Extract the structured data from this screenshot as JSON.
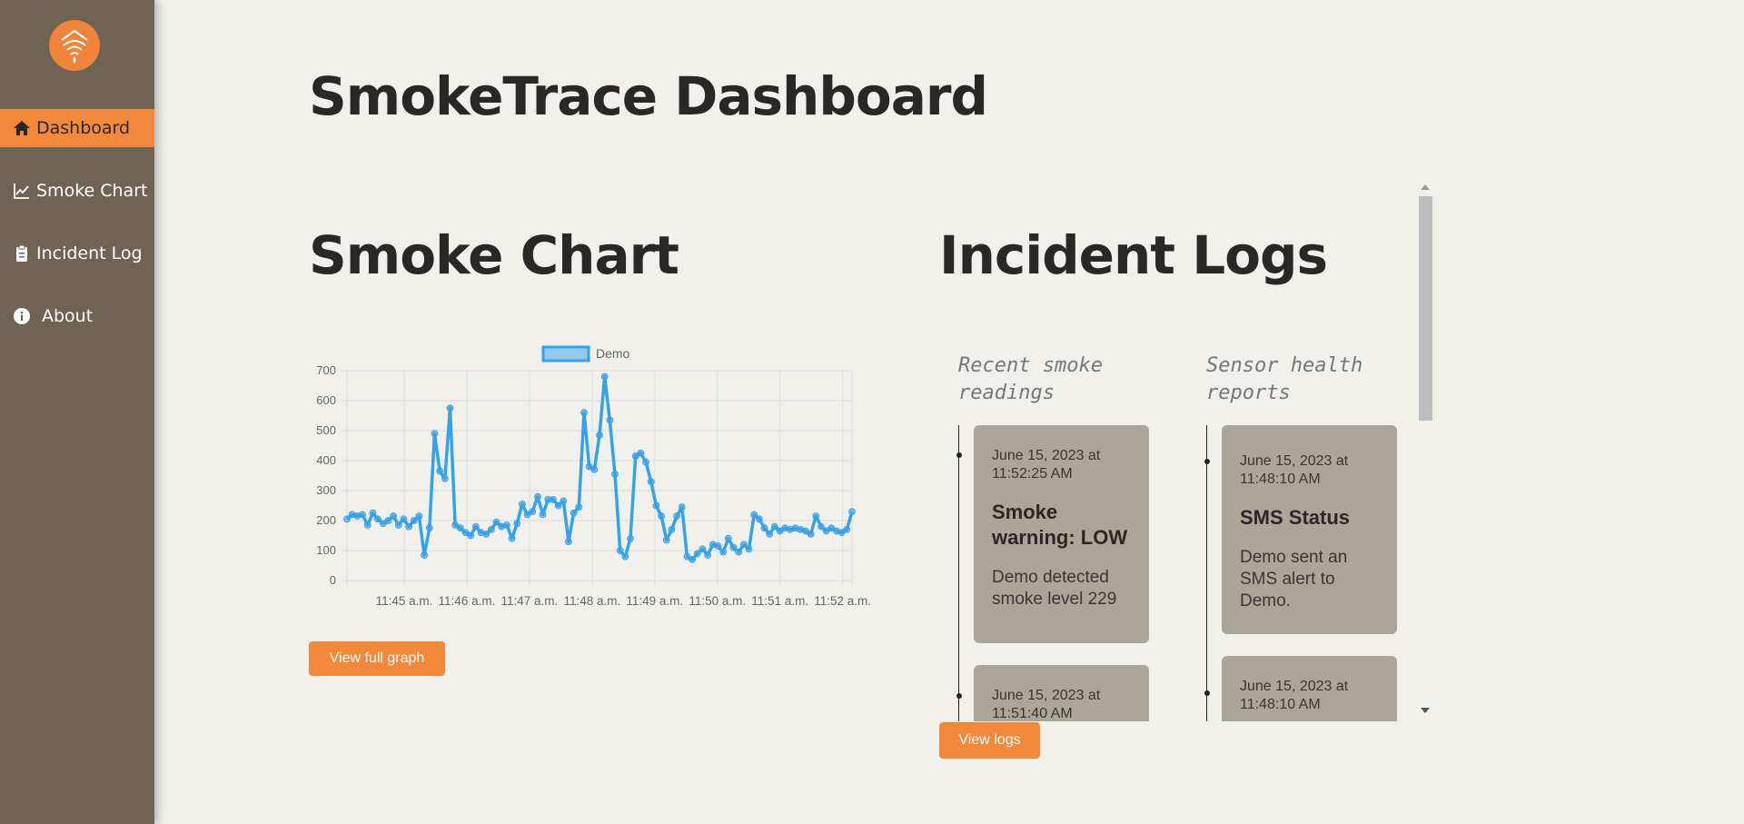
{
  "brand": {
    "logo_icon": "wifi-flame-icon",
    "accent": "#f2893a",
    "sidebar_bg": "#6f6454"
  },
  "nav": {
    "items": [
      {
        "label": "Dashboard",
        "icon": "home-icon",
        "active": true
      },
      {
        "label": "Smoke Chart",
        "icon": "line-chart-icon",
        "active": false
      },
      {
        "label": "Incident Log",
        "icon": "clipboard-icon",
        "active": false
      },
      {
        "label": "About",
        "icon": "info-icon",
        "active": false
      }
    ]
  },
  "page_title": "SmokeTrace Dashboard",
  "smoke_chart": {
    "title": "Smoke Chart",
    "button_label": "View full graph"
  },
  "chart_data": {
    "type": "line",
    "legend": [
      "Demo"
    ],
    "legend_position": "top",
    "grid": true,
    "ylim": [
      0,
      700
    ],
    "yticks": [
      0,
      100,
      200,
      300,
      400,
      500,
      600,
      700
    ],
    "xtick_labels": [
      "11:45 a.m.",
      "11:46 a.m.",
      "11:47 a.m.",
      "11:48 a.m.",
      "11:49 a.m.",
      "11:50 a.m.",
      "11:51 a.m.",
      "11:52 a.m."
    ],
    "series": [
      {
        "name": "Demo",
        "color": "#36a2eb",
        "values": [
          205,
          220,
          215,
          220,
          185,
          225,
          205,
          190,
          200,
          215,
          185,
          205,
          180,
          200,
          215,
          85,
          175,
          490,
          365,
          340,
          575,
          185,
          175,
          160,
          150,
          180,
          160,
          155,
          170,
          195,
          180,
          185,
          140,
          190,
          255,
          220,
          230,
          280,
          220,
          270,
          270,
          250,
          265,
          130,
          225,
          245,
          560,
          380,
          370,
          485,
          680,
          535,
          355,
          100,
          80,
          140,
          415,
          425,
          395,
          330,
          250,
          215,
          135,
          170,
          215,
          245,
          80,
          70,
          90,
          105,
          85,
          120,
          115,
          95,
          140,
          110,
          95,
          120,
          105,
          220,
          205,
          175,
          155,
          180,
          165,
          175,
          170,
          175,
          170,
          165,
          155,
          215,
          180,
          165,
          175,
          165,
          160,
          170,
          230
        ]
      }
    ]
  },
  "incident_logs": {
    "title": "Incident Logs",
    "button_label": "View logs",
    "columns": [
      {
        "title": "Recent smoke readings",
        "cards": [
          {
            "timestamp": "June 15, 2023 at 11:52:25 AM",
            "title": "Smoke warning: LOW",
            "body": "Demo detected smoke level 229"
          },
          {
            "timestamp": "June 15, 2023 at 11:51:40 AM",
            "title": "",
            "body": ""
          }
        ]
      },
      {
        "title": "Sensor health reports",
        "cards": [
          {
            "timestamp": "June 15, 2023 at 11:48:10 AM",
            "title": "SMS Status",
            "body": "Demo sent an SMS alert to Demo."
          },
          {
            "timestamp": "June 15, 2023 at 11:48:10 AM",
            "title": "",
            "body": ""
          }
        ]
      }
    ]
  }
}
